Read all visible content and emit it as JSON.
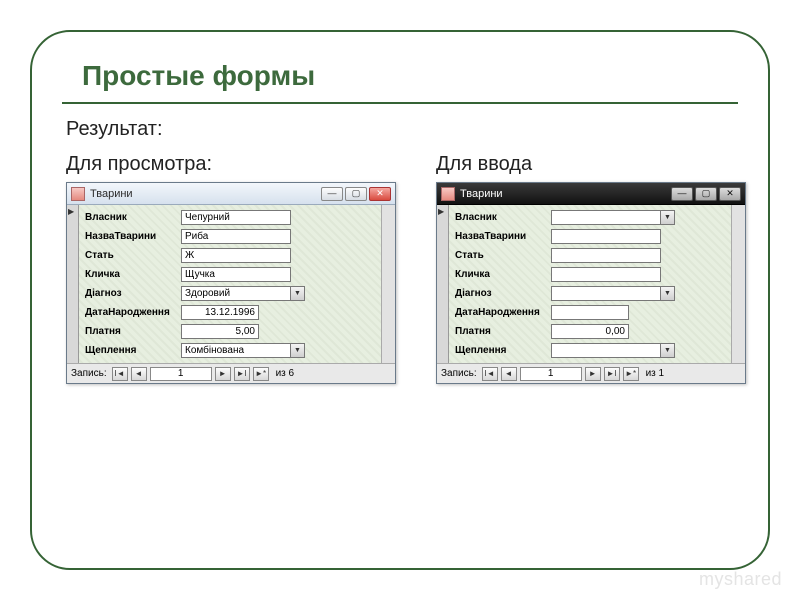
{
  "slide": {
    "title": "Простые формы",
    "result_label": "Результат:",
    "view_label": "Для просмотра:",
    "entry_label": "Для ввода"
  },
  "window_view": {
    "title": "Тварини",
    "fields": {
      "owner": {
        "label": "Власник",
        "value": "Чепурний"
      },
      "animal": {
        "label": "НазваТварини",
        "value": "Риба"
      },
      "sex": {
        "label": "Стать",
        "value": "Ж"
      },
      "nick": {
        "label": "Кличка",
        "value": "Щучка"
      },
      "diag": {
        "label": "Діагноз",
        "value": "Здоровий"
      },
      "dob": {
        "label": "ДатаНародження",
        "value": "13.12.1996"
      },
      "pay": {
        "label": "Платня",
        "value": "5,00"
      },
      "vacc": {
        "label": "Щеплення",
        "value": "Комбінована"
      }
    },
    "nav": {
      "label": "Запись:",
      "current": "1",
      "total": "из 6"
    }
  },
  "window_entry": {
    "title": "Тварини",
    "fields": {
      "owner": {
        "label": "Власник",
        "value": ""
      },
      "animal": {
        "label": "НазваТварини",
        "value": ""
      },
      "sex": {
        "label": "Стать",
        "value": ""
      },
      "nick": {
        "label": "Кличка",
        "value": ""
      },
      "diag": {
        "label": "Діагноз",
        "value": ""
      },
      "dob": {
        "label": "ДатаНародження",
        "value": ""
      },
      "pay": {
        "label": "Платня",
        "value": "0,00"
      },
      "vacc": {
        "label": "Щеплення",
        "value": ""
      }
    },
    "nav": {
      "label": "Запись:",
      "current": "1",
      "total": "из 1"
    }
  },
  "watermark": "myshared"
}
